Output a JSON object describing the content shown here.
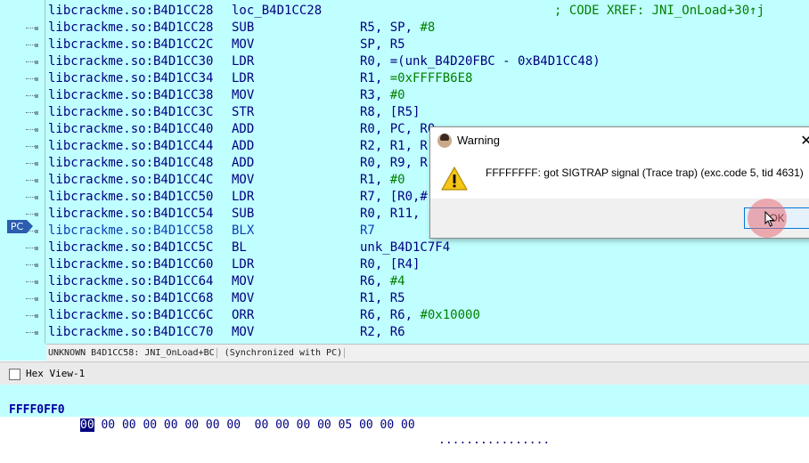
{
  "disasm": {
    "rows": [
      {
        "addr": "libcrackme.so:B4D1CC28",
        "mn": "loc_B4D1CC28",
        "op": "",
        "imm": "",
        "comment": "; CODE XREF: JNI_OnLoad+30↑j",
        "dot": false
      },
      {
        "addr": "libcrackme.so:B4D1CC28",
        "mn": "SUB",
        "op": "R5, SP, ",
        "imm": "#8",
        "comment": "",
        "dot": true
      },
      {
        "addr": "libcrackme.so:B4D1CC2C",
        "mn": "MOV",
        "op": "SP, R5",
        "imm": "",
        "comment": "",
        "dot": true
      },
      {
        "addr": "libcrackme.so:B4D1CC30",
        "mn": "LDR",
        "op": "R0, =(unk_B4D20FBC - 0xB4D1CC48)",
        "imm": "",
        "comment": "",
        "dot": true
      },
      {
        "addr": "libcrackme.so:B4D1CC34",
        "mn": "LDR",
        "op": "R1, ",
        "imm": "=0xFFFFB6E8",
        "comment": "",
        "dot": true
      },
      {
        "addr": "libcrackme.so:B4D1CC38",
        "mn": "MOV",
        "op": "R3, ",
        "imm": "#0",
        "comment": "",
        "dot": true
      },
      {
        "addr": "libcrackme.so:B4D1CC3C",
        "mn": "STR",
        "op": "R8, [R5]",
        "imm": "",
        "comment": "",
        "dot": true
      },
      {
        "addr": "libcrackme.so:B4D1CC40",
        "mn": "ADD",
        "op": "R0, PC, R0",
        "imm": "",
        "comment": "",
        "dot": true
      },
      {
        "addr": "libcrackme.so:B4D1CC44",
        "mn": "ADD",
        "op": "R2, R1, R",
        "imm": "",
        "comment": "",
        "dot": true
      },
      {
        "addr": "libcrackme.so:B4D1CC48",
        "mn": "ADD",
        "op": "R0, R9, R",
        "imm": "",
        "comment": "",
        "dot": true
      },
      {
        "addr": "libcrackme.so:B4D1CC4C",
        "mn": "MOV",
        "op": "R1, ",
        "imm": "#0",
        "comment": "",
        "dot": true
      },
      {
        "addr": "libcrackme.so:B4D1CC50",
        "mn": "LDR",
        "op": "R7, [R0,#",
        "imm": "",
        "comment": "",
        "dot": true
      },
      {
        "addr": "libcrackme.so:B4D1CC54",
        "mn": "SUB",
        "op": "R0, R11,",
        "imm": "",
        "comment": "",
        "dot": true
      },
      {
        "addr": "libcrackme.so:B4D1CC58",
        "mn": "BLX",
        "op": "R7",
        "imm": "",
        "comment": "",
        "dot": true,
        "hl": true
      },
      {
        "addr": "libcrackme.so:B4D1CC5C",
        "mn": "BL",
        "op": "unk_B4D1C7F4",
        "imm": "",
        "comment": "",
        "dot": true
      },
      {
        "addr": "libcrackme.so:B4D1CC60",
        "mn": "LDR",
        "op": "R0, [R4]",
        "imm": "",
        "comment": "",
        "dot": true
      },
      {
        "addr": "libcrackme.so:B4D1CC64",
        "mn": "MOV",
        "op": "R6, ",
        "imm": "#4",
        "comment": "",
        "dot": true
      },
      {
        "addr": "libcrackme.so:B4D1CC68",
        "mn": "MOV",
        "op": "R1, R5",
        "imm": "",
        "comment": "",
        "dot": true
      },
      {
        "addr": "libcrackme.so:B4D1CC6C",
        "mn": "ORR",
        "op": "R6, R6, ",
        "imm": "#0x10000",
        "comment": "",
        "dot": true
      },
      {
        "addr": "libcrackme.so:B4D1CC70",
        "mn": "MOV",
        "op": "R2, R6",
        "imm": "",
        "comment": "",
        "dot": true
      }
    ],
    "pc_label": "PC"
  },
  "status": {
    "location": "UNKNOWN B4D1CC58: JNI_OnLoad+BC",
    "sync": "(Synchronized with PC)"
  },
  "hex": {
    "tab_label": "Hex View-1",
    "addr": "FFFF0FF0",
    "selected_byte": "00",
    "bytes": " 00 00 00 00 00 00 00  00 00 00 00 05 00 00 00",
    "ascii": "................"
  },
  "dialog": {
    "title": "Warning",
    "message": "FFFFFFFF: got SIGTRAP signal (Trace trap) (exc.code 5, tid 4631)",
    "ok_label": "OK",
    "close_glyph": "✕"
  },
  "colors": {
    "background": "#c0ffff",
    "code_text": "#000080",
    "immediate": "#008000",
    "highlight": "#0a3fb5",
    "pc_badge": "#2a5db0"
  }
}
